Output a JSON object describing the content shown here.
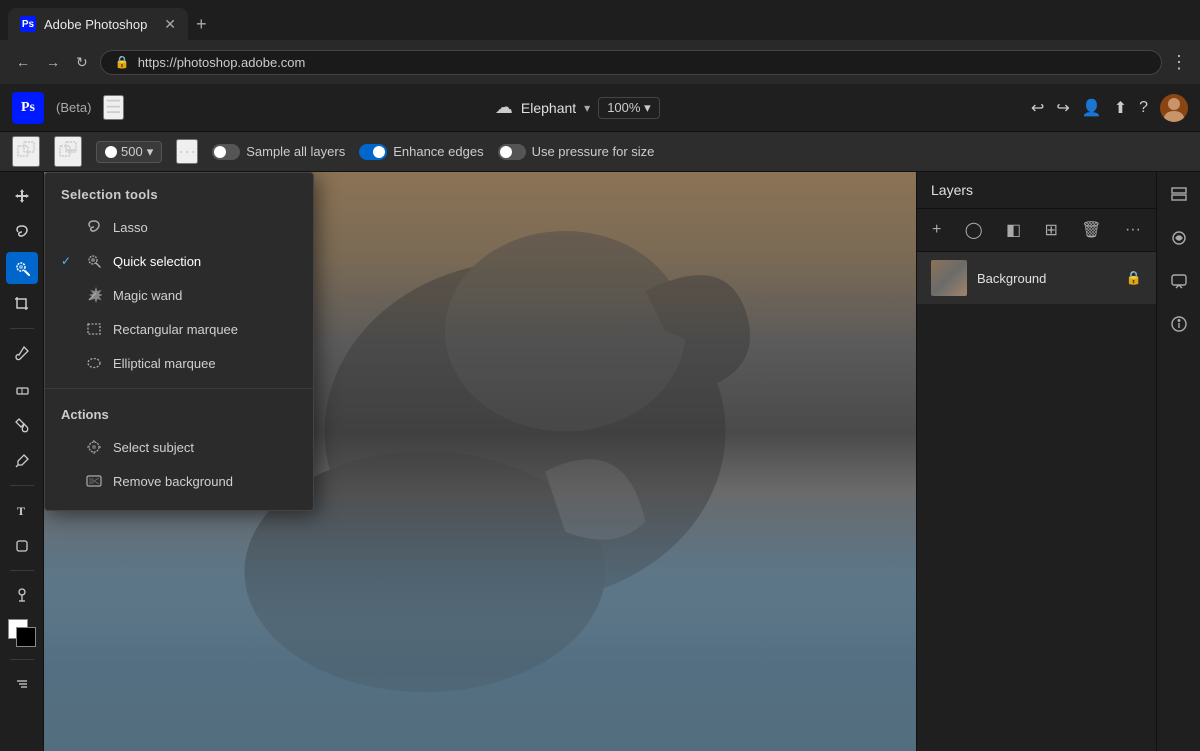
{
  "browser": {
    "tab_title": "Adobe Photoshop",
    "tab_favicon": "Ps",
    "url": "https://photoshop.adobe.com",
    "new_tab_label": "+"
  },
  "app": {
    "title": "Adobe Photoshop",
    "beta_label": "(Beta)",
    "filename": "Elephant",
    "zoom": "100%",
    "layers_title": "Layers"
  },
  "options_bar": {
    "brush_size": "500",
    "sample_all_layers": "Sample all layers",
    "enhance_edges": "Enhance edges",
    "use_pressure": "Use pressure for size"
  },
  "selection_tools": {
    "section_title": "Selection tools",
    "items": [
      {
        "id": "lasso",
        "label": "Lasso",
        "active": false
      },
      {
        "id": "quick-selection",
        "label": "Quick selection",
        "active": true
      },
      {
        "id": "magic-wand",
        "label": "Magic wand",
        "active": false
      },
      {
        "id": "rect-marquee",
        "label": "Rectangular marquee",
        "active": false
      },
      {
        "id": "ellip-marquee",
        "label": "Elliptical marquee",
        "active": false
      }
    ]
  },
  "actions": {
    "section_title": "Actions",
    "items": [
      {
        "id": "select-subject",
        "label": "Select subject"
      },
      {
        "id": "remove-bg",
        "label": "Remove background"
      }
    ]
  },
  "layers": {
    "title": "Layers",
    "items": [
      {
        "name": "Background",
        "locked": true
      }
    ]
  }
}
